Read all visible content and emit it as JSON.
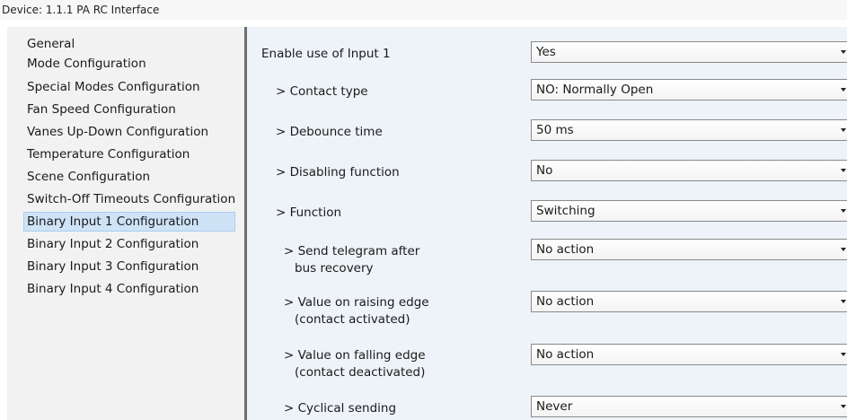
{
  "title": "Device: 1.1.1  PA RC Interface",
  "nav": {
    "items": [
      {
        "label": "General"
      },
      {
        "label": "Mode Configuration"
      },
      {
        "label": "Special Modes Configuration"
      },
      {
        "label": "Fan Speed Configuration"
      },
      {
        "label": "Vanes Up-Down Configuration"
      },
      {
        "label": "Temperature Configuration"
      },
      {
        "label": "Scene Configuration"
      },
      {
        "label": "Switch-Off Timeouts Configuration"
      },
      {
        "label": "Binary Input 1 Configuration",
        "selected": true
      },
      {
        "label": "Binary Input 2 Configuration"
      },
      {
        "label": "Binary Input 3 Configuration"
      },
      {
        "label": "Binary Input 4 Configuration"
      }
    ]
  },
  "params": [
    {
      "label": "Enable use of Input 1",
      "value": "Yes"
    },
    {
      "label": "> Contact type",
      "value": "NO: Normally Open"
    },
    {
      "label": "> Debounce time",
      "value": "50 ms"
    },
    {
      "label": "> Disabling function",
      "value": "No"
    },
    {
      "label": "> Function",
      "value": "Switching"
    },
    {
      "label_line1": "> Send telegram after",
      "label_line2": "bus recovery",
      "value": "No action"
    },
    {
      "label_line1": "> Value on raising edge",
      "label_line2": "(contact activated)",
      "value": "No action"
    },
    {
      "label_line1": "> Value on falling edge",
      "label_line2": "(contact deactivated)",
      "value": "No action"
    },
    {
      "label": "> Cyclical sending",
      "value": "Never"
    }
  ],
  "colors": {
    "selection": "#cfe3f7",
    "right_panel": "#eef3f9",
    "left_panel": "#f2f2f2",
    "divider": "#6e6e6e"
  },
  "icons": {
    "dropdown_arrow": "chevron-down-icon"
  }
}
